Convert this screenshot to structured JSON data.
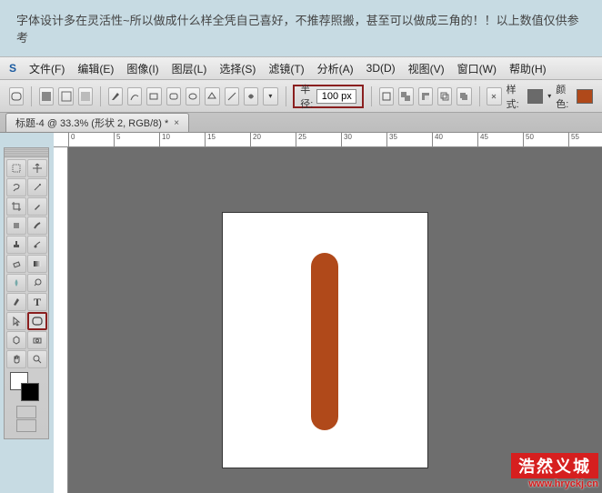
{
  "banner": "字体设计多在灵活性~所以做成什么样全凭自己喜好，不推荐照搬，甚至可以做成三角的！！以上数值仅供参考",
  "menu": {
    "ps": "S",
    "file": "文件(F)",
    "edit": "编辑(E)",
    "image": "图像(I)",
    "layer": "图层(L)",
    "select": "选择(S)",
    "filter": "滤镜(T)",
    "analysis": "分析(A)",
    "threeD": "3D(D)",
    "view": "视图(V)",
    "window": "窗口(W)",
    "help": "帮助(H)"
  },
  "options": {
    "radius_label": "半径:",
    "radius_value": "100 px",
    "style_label": "样式:",
    "color_label": "颜色:",
    "color_swatch": "#b0491a",
    "style_swatch": "#6a6a6a"
  },
  "tab": {
    "title": "标题-4 @ 33.3% (形状 2, RGB/8) *",
    "close": "×"
  },
  "ruler_ticks": [
    {
      "pos": 0,
      "label": "0"
    },
    {
      "pos": 50,
      "label": "5"
    },
    {
      "pos": 100,
      "label": "10"
    },
    {
      "pos": 150,
      "label": "15"
    },
    {
      "pos": 200,
      "label": "20"
    },
    {
      "pos": 250,
      "label": "25"
    },
    {
      "pos": 300,
      "label": "30"
    },
    {
      "pos": 350,
      "label": "35"
    },
    {
      "pos": 400,
      "label": "40"
    },
    {
      "pos": 450,
      "label": "45"
    },
    {
      "pos": 500,
      "label": "50"
    },
    {
      "pos": 550,
      "label": "55"
    }
  ],
  "watermark": {
    "line1": "浩然义城",
    "line2": "www.hryckj.cn"
  }
}
